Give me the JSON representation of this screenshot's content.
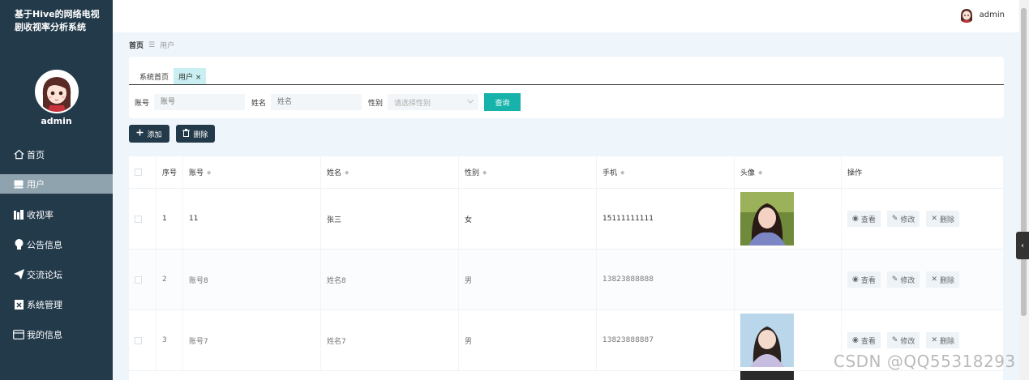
{
  "sidebar": {
    "title": "基于Hive的网络电视剧收视率分析系统",
    "username": "admin",
    "items": [
      {
        "label": "首页",
        "icon": "home-icon"
      },
      {
        "label": "用户",
        "icon": "card-icon"
      },
      {
        "label": "收视率",
        "icon": "chart-icon"
      },
      {
        "label": "公告信息",
        "icon": "bulb-icon"
      },
      {
        "label": "交流论坛",
        "icon": "send-icon"
      },
      {
        "label": "系统管理",
        "icon": "clipboard-icon"
      },
      {
        "label": "我的信息",
        "icon": "id-card-icon"
      }
    ],
    "active_index": 1
  },
  "topbar": {
    "username": "admin"
  },
  "breadcrumb": {
    "home": "首页",
    "sep": "☰",
    "current": "用户"
  },
  "tabs": [
    {
      "label": "系统首页"
    },
    {
      "label": "用户 ×"
    }
  ],
  "filters": {
    "account_label": "账号",
    "account_placeholder": "账号",
    "name_label": "姓名",
    "name_placeholder": "姓名",
    "gender_label": "性别",
    "gender_placeholder": "请选择性别",
    "search_label": "查询"
  },
  "actions": {
    "add_label": "添加",
    "delete_label": "删除"
  },
  "table": {
    "headers": {
      "index": "序号",
      "account": "账号",
      "name": "姓名",
      "gender": "性别",
      "phone": "手机",
      "avatar": "头像",
      "ops": "操作"
    },
    "rows": [
      {
        "index": "1",
        "account": "11",
        "name": "张三",
        "gender": "女",
        "phone": "15111111111",
        "has_photo": true
      },
      {
        "index": "2",
        "account": "账号8",
        "name": "姓名8",
        "gender": "男",
        "phone": "13823888888",
        "has_photo": false
      },
      {
        "index": "3",
        "account": "账号7",
        "name": "姓名7",
        "gender": "男",
        "phone": "13823888887",
        "has_photo": true
      }
    ],
    "op_view": "查看",
    "op_edit": "修改",
    "op_delete": "删除"
  },
  "watermark": "CSDN @QQ55318293",
  "colors": {
    "sidebar": "#233a4b",
    "active_menu": "#8ea3ae",
    "accent": "#17b3ab",
    "page_bg": "#eef5fb"
  }
}
